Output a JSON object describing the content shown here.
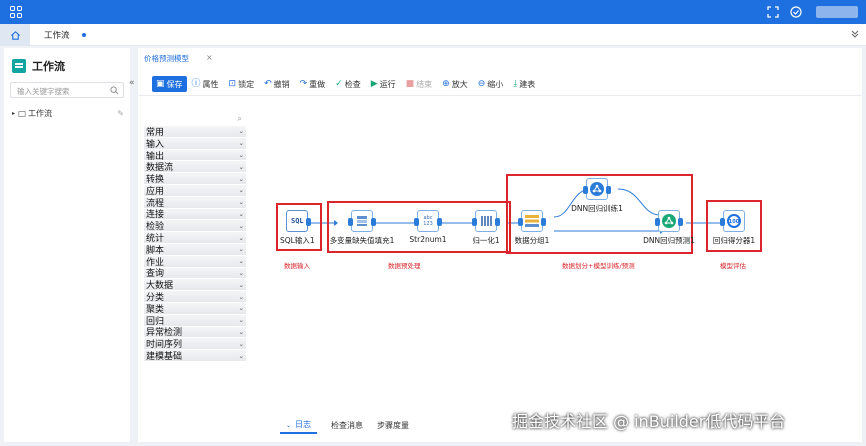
{
  "header": {
    "apps_icon": "grid-icon",
    "right_icons": [
      "expand-icon",
      "check-circle-icon",
      "user-avatar"
    ]
  },
  "tabs": {
    "home_icon": "home-icon",
    "active_tab": "工作流"
  },
  "sidebar": {
    "title": "工作流",
    "search_placeholder": "输入关键字搜索",
    "tree_item": "工作流"
  },
  "editor": {
    "doc_tab": "价格预测模型",
    "toolbar": [
      {
        "label": "保存",
        "icon": "save-icon",
        "primary": true,
        "disabled": false
      },
      {
        "label": "属性",
        "icon": "info-icon",
        "primary": false,
        "disabled": false
      },
      {
        "label": "锁定",
        "icon": "lock-icon",
        "primary": false,
        "disabled": false
      },
      {
        "label": "撤销",
        "icon": "undo-icon",
        "primary": false,
        "disabled": false
      },
      {
        "label": "重做",
        "icon": "redo-icon",
        "primary": false,
        "disabled": false
      },
      {
        "label": "检查",
        "icon": "check-icon",
        "primary": false,
        "disabled": false
      },
      {
        "label": "运行",
        "icon": "play-icon",
        "primary": false,
        "disabled": false
      },
      {
        "label": "结束",
        "icon": "stop-icon",
        "primary": false,
        "disabled": true
      },
      {
        "label": "放大",
        "icon": "zoom-in-icon",
        "primary": false,
        "disabled": false
      },
      {
        "label": "缩小",
        "icon": "zoom-out-icon",
        "primary": false,
        "disabled": false
      },
      {
        "label": "建表",
        "icon": "table-icon",
        "primary": false,
        "disabled": false
      }
    ],
    "components": [
      "常用",
      "输入",
      "输出",
      "数据流",
      "转换",
      "应用",
      "流程",
      "连接",
      "检验",
      "统计",
      "脚本",
      "作业",
      "查询",
      "大数据",
      "分类",
      "聚类",
      "回归",
      "异常检测",
      "时间序列",
      "建模基础"
    ],
    "nodes": {
      "sql": "SQL输入1",
      "fill": "多变量缺失值填充1",
      "str2num": "Str2num1",
      "norm": "归一化1",
      "split": "数据分组1",
      "train": "DNN回归训练1",
      "predict": "DNN回归预测1",
      "score": "回归得分器1"
    },
    "groups": {
      "input": "数据输入",
      "preprocess": "数据预处理",
      "model": "数据划分+模型训练/预测",
      "eval": "模型评估"
    },
    "bottom_tabs": [
      "日志",
      "检查消息",
      "步骤度量"
    ]
  },
  "watermark": "掘金技术社区 @ inBuilder低代码平台"
}
